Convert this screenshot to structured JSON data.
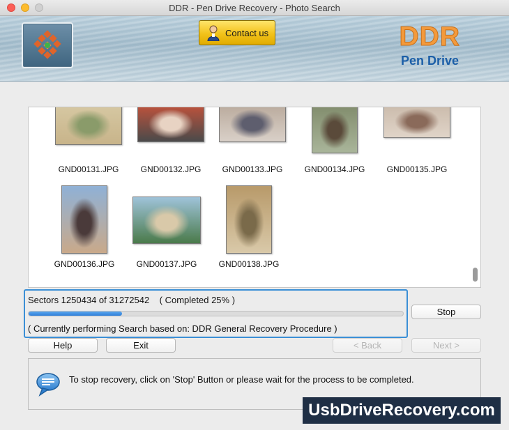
{
  "window": {
    "title": "DDR - Pen Drive Recovery - Photo Search"
  },
  "header": {
    "contact_label": "Contact us",
    "brand_name": "DDR",
    "brand_subtitle": "Pen Drive"
  },
  "gallery": {
    "items": [
      {
        "name": "GND00131.JPG",
        "colors": [
          "#d7c9a4",
          "#8a9b6a",
          "#c8b48a"
        ]
      },
      {
        "name": "GND00132.JPG",
        "colors": [
          "#c7533b",
          "#e8d3c3",
          "#4a4a4a"
        ]
      },
      {
        "name": "GND00133.JPG",
        "colors": [
          "#b8a89a",
          "#5e5e6e",
          "#d9d0c8"
        ]
      },
      {
        "name": "GND00134.JPG",
        "colors": [
          "#7f8a6a",
          "#5a4a3a",
          "#a9b59a"
        ]
      },
      {
        "name": "GND00135.JPG",
        "colors": [
          "#c9b9a9",
          "#8a6a5a",
          "#e0d4c8"
        ]
      },
      {
        "name": "GND00136.JPG",
        "colors": [
          "#8fb1d6",
          "#4a3a3a",
          "#c9a98a"
        ]
      },
      {
        "name": "GND00137.JPG",
        "colors": [
          "#9fc3d9",
          "#d9c9a9",
          "#4a7a4a"
        ]
      },
      {
        "name": "GND00138.JPG",
        "colors": [
          "#b89a6a",
          "#7a6a4a",
          "#d9c9a9"
        ]
      }
    ]
  },
  "progress": {
    "sectors_text": "Sectors 1250434 of 31272542    ( Completed 25% )",
    "percent": 25,
    "procedure_text": "( Currently performing Search based on: DDR General Recovery Procedure )"
  },
  "buttons": {
    "stop": "Stop",
    "help": "Help",
    "exit": "Exit",
    "back": "< Back",
    "next": "Next >"
  },
  "info": {
    "message": "To stop recovery, click on 'Stop' Button or please wait for the process to be completed."
  },
  "watermark": "UsbDriveRecovery.com",
  "colors": {
    "accent": "#3b8fd6",
    "brand_orange": "#f39a3c",
    "brand_blue": "#1c5fa8"
  }
}
